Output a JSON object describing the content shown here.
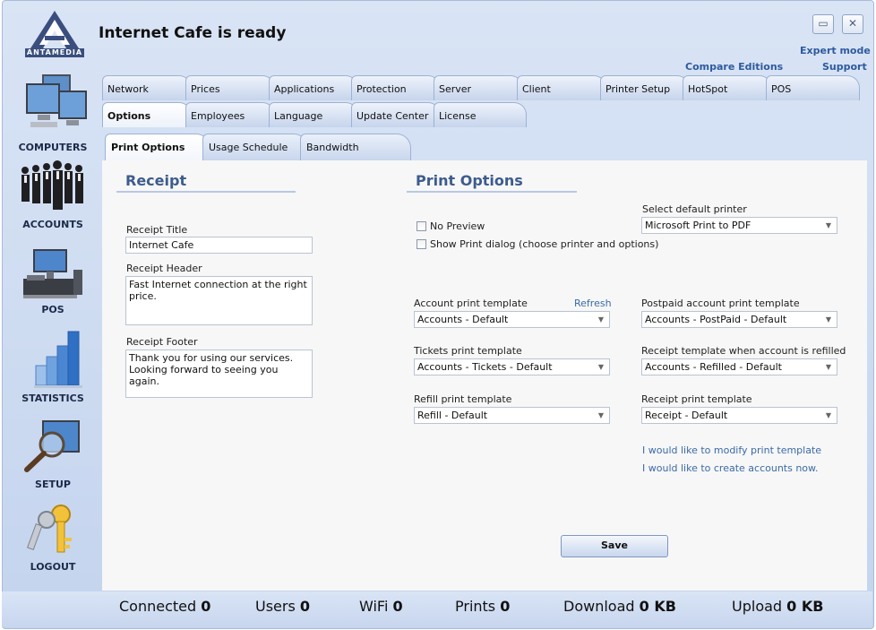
{
  "app": {
    "title": "Internet Cafe is ready",
    "logo_text": "ANTAMEDIA",
    "minimize_glyph": "▭",
    "close_glyph": "✕"
  },
  "links": {
    "expert_mode": "Expert mode",
    "compare_editions": "Compare Editions",
    "support": "Support"
  },
  "sidebar": {
    "items": [
      {
        "label": "COMPUTERS",
        "icon": "computers-icon"
      },
      {
        "label": "ACCOUNTS",
        "icon": "accounts-icon"
      },
      {
        "label": "POS",
        "icon": "pos-icon"
      },
      {
        "label": "STATISTICS",
        "icon": "statistics-icon"
      },
      {
        "label": "SETUP",
        "icon": "setup-icon"
      },
      {
        "label": "LOGOUT",
        "icon": "logout-icon"
      }
    ]
  },
  "tabs_row1": [
    "Network",
    "Prices",
    "Applications",
    "Protection",
    "Server",
    "Client",
    "Printer Setup",
    "HotSpot",
    "POS"
  ],
  "tabs_row2": [
    "Options",
    "Employees",
    "Language",
    "Update Center",
    "License"
  ],
  "subtabs": [
    "Print Options",
    "Usage Schedule",
    "Bandwidth"
  ],
  "receipt": {
    "section_title": "Receipt",
    "title_label": "Receipt Title",
    "title_value": "Internet Cafe",
    "header_label": "Receipt Header",
    "header_value": "Fast Internet connection at the right price.",
    "footer_label": "Receipt Footer",
    "footer_value": "Thank you for using our services.\nLooking forward to seeing you again."
  },
  "print_options": {
    "section_title": "Print Options",
    "no_preview": "No Preview",
    "show_print_dialog": "Show Print dialog (choose printer and options)",
    "default_printer_label": "Select default printer",
    "default_printer_value": "Microsoft Print to PDF",
    "account_template_label": "Account print template",
    "refresh": "Refresh",
    "account_template_value": "Accounts - Default",
    "postpaid_template_label": "Postpaid account print template",
    "postpaid_template_value": "Accounts - PostPaid - Default",
    "tickets_template_label": "Tickets print template",
    "tickets_template_value": "Accounts - Tickets - Default",
    "refilled_template_label": "Receipt template when account is refilled",
    "refilled_template_value": "Accounts - Refilled - Default",
    "refill_template_label": "Refill print template",
    "refill_template_value": "Refill - Default",
    "receipt_template_label": "Receipt print template",
    "receipt_template_value": "Receipt - Default",
    "modify_link": "I would like to modify print template",
    "create_link": "I would like to create accounts now."
  },
  "save_label": "Save",
  "status": {
    "connected_label": "Connected",
    "connected_value": "0",
    "users_label": "Users",
    "users_value": "0",
    "wifi_label": "WiFi",
    "wifi_value": "0",
    "prints_label": "Prints",
    "prints_value": "0",
    "download_label": "Download",
    "download_value": "0 KB",
    "upload_label": "Upload",
    "upload_value": "0 KB"
  },
  "colors": {
    "accent": "#3d5c8e",
    "link": "#3a6aa8",
    "frame": "#c4d4ee"
  }
}
